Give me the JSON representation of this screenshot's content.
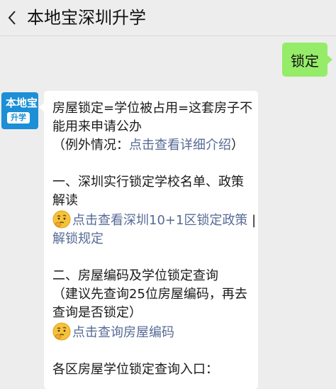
{
  "header": {
    "title": "本地宝深圳升学"
  },
  "outgoing_message": {
    "text": "锁定"
  },
  "sender": {
    "avatar_line1": "本地宝",
    "avatar_line2": "升学"
  },
  "message": {
    "intro_line1": "房屋锁定=学位被占用=这套房子不",
    "intro_line2": "能用来申请公办",
    "exception_prefix": "（例外情况：",
    "exception_link": "点击查看详细介绍",
    "exception_suffix": "）",
    "section1_line1": "一、深圳实行锁定学校名单、政策",
    "section1_line2": "解读",
    "section1_link_line1": "点击查看深圳10+1区锁定政策",
    "section1_separator": " |",
    "section1_link_line2": "解锁规定",
    "section2_line1": "二、房屋编码及学位锁定查询",
    "section2_line2": "（建议先查询25位房屋编码，再去",
    "section2_line3": "查询是否锁定）",
    "section2_link": "点击查询房屋编码",
    "section3_line1": "各区房屋学位锁定查询入口："
  },
  "colors": {
    "link": "#576b95",
    "bubble_out": "#95ec69",
    "avatar_bg": "#1c8fd6"
  }
}
